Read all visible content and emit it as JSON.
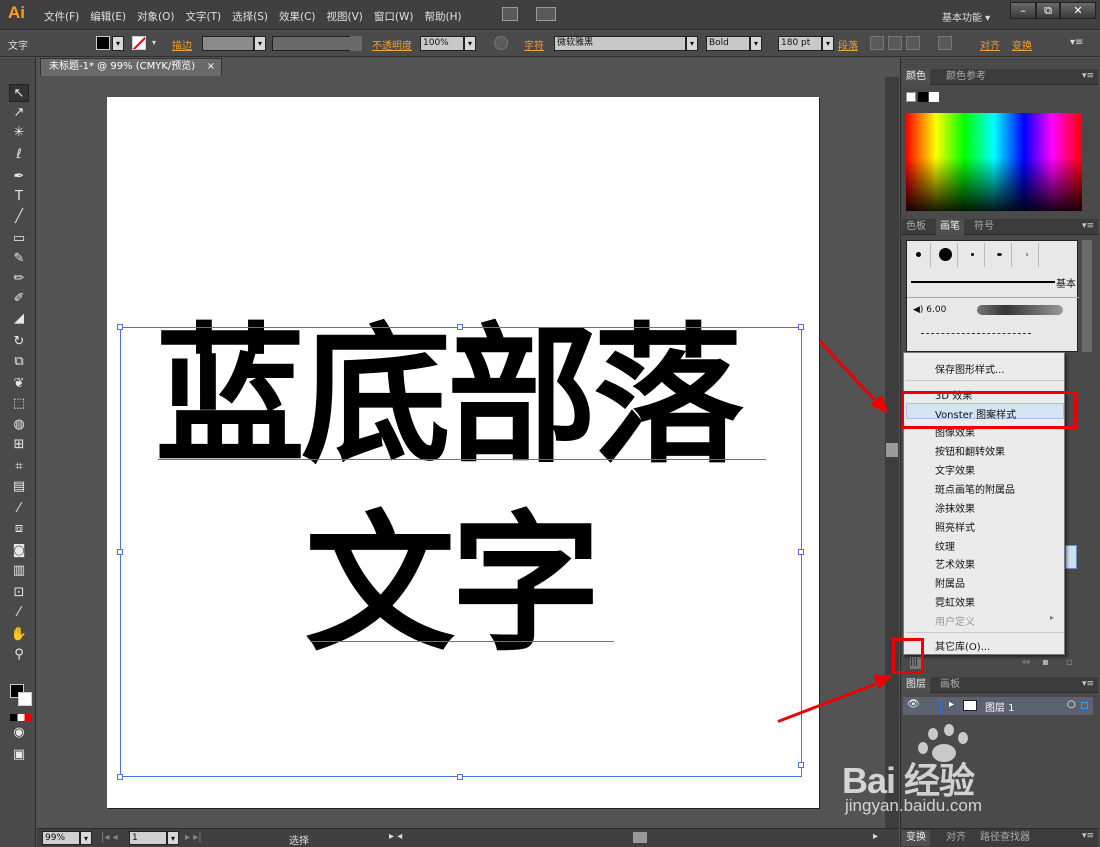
{
  "menubar": {
    "logo": "Ai",
    "items": [
      "文件(F)",
      "编辑(E)",
      "对象(O)",
      "文字(T)",
      "选择(S)",
      "效果(C)",
      "视图(V)",
      "窗口(W)",
      "帮助(H)"
    ],
    "workspace": "基本功能",
    "window_buttons": [
      "–",
      "⧉",
      "✕"
    ]
  },
  "control": {
    "tool_label": "文字",
    "stroke_label": "描边",
    "opacity_label": "不透明度",
    "opacity_value": "100%",
    "char_label": "字符",
    "font_family": "微软雅黑",
    "font_style": "Bold",
    "font_size": "180 pt",
    "para_label": "段落",
    "align_label": "对齐",
    "transform_label": "变换"
  },
  "document": {
    "tab_title": "未标题-1* @ 99% (CMYK/预览)",
    "tab_close": "×"
  },
  "artwork": {
    "line1": "蓝底部落",
    "line2": "文字"
  },
  "status": {
    "zoom": "99%",
    "artboard": "1",
    "tool": "选择"
  },
  "panels": {
    "color_tabs": [
      "颜色",
      "颜色参考"
    ],
    "swatch_tabs": [
      "色板",
      "画笔",
      "符号"
    ],
    "brush_basic": "基本",
    "brush_size": "6.00",
    "layers_tabs": [
      "图层",
      "画板"
    ],
    "layer_name": "图层 1",
    "bottom_tabs": [
      "变换",
      "对齐",
      "路径查找器"
    ]
  },
  "flyout": {
    "items": [
      {
        "label": "保存图形样式...",
        "disabled": false
      },
      {
        "label": "3D 效果",
        "disabled": false
      },
      {
        "label": "Vonster 图案样式",
        "disabled": false,
        "highlighted": true
      },
      {
        "label": "图像效果",
        "disabled": false
      },
      {
        "label": "按钮和翻转效果",
        "disabled": false
      },
      {
        "label": "文字效果",
        "disabled": false
      },
      {
        "label": "斑点画笔的附属品",
        "disabled": false
      },
      {
        "label": "涂抹效果",
        "disabled": false
      },
      {
        "label": "照亮样式",
        "disabled": false
      },
      {
        "label": "纹理",
        "disabled": false
      },
      {
        "label": "艺术效果",
        "disabled": false
      },
      {
        "label": "附属品",
        "disabled": false
      },
      {
        "label": "霓虹效果",
        "disabled": false
      },
      {
        "label": "用户定义",
        "disabled": true,
        "submenu": true
      },
      {
        "label": "其它库(O)...",
        "disabled": false
      }
    ]
  },
  "watermark": {
    "logo": "Bai  经验",
    "url": "jingyan.baidu.com"
  },
  "colors": {
    "accent_orange": "#f7a11a",
    "annotation_red": "#e00000",
    "selection_blue": "#4a72d8"
  }
}
